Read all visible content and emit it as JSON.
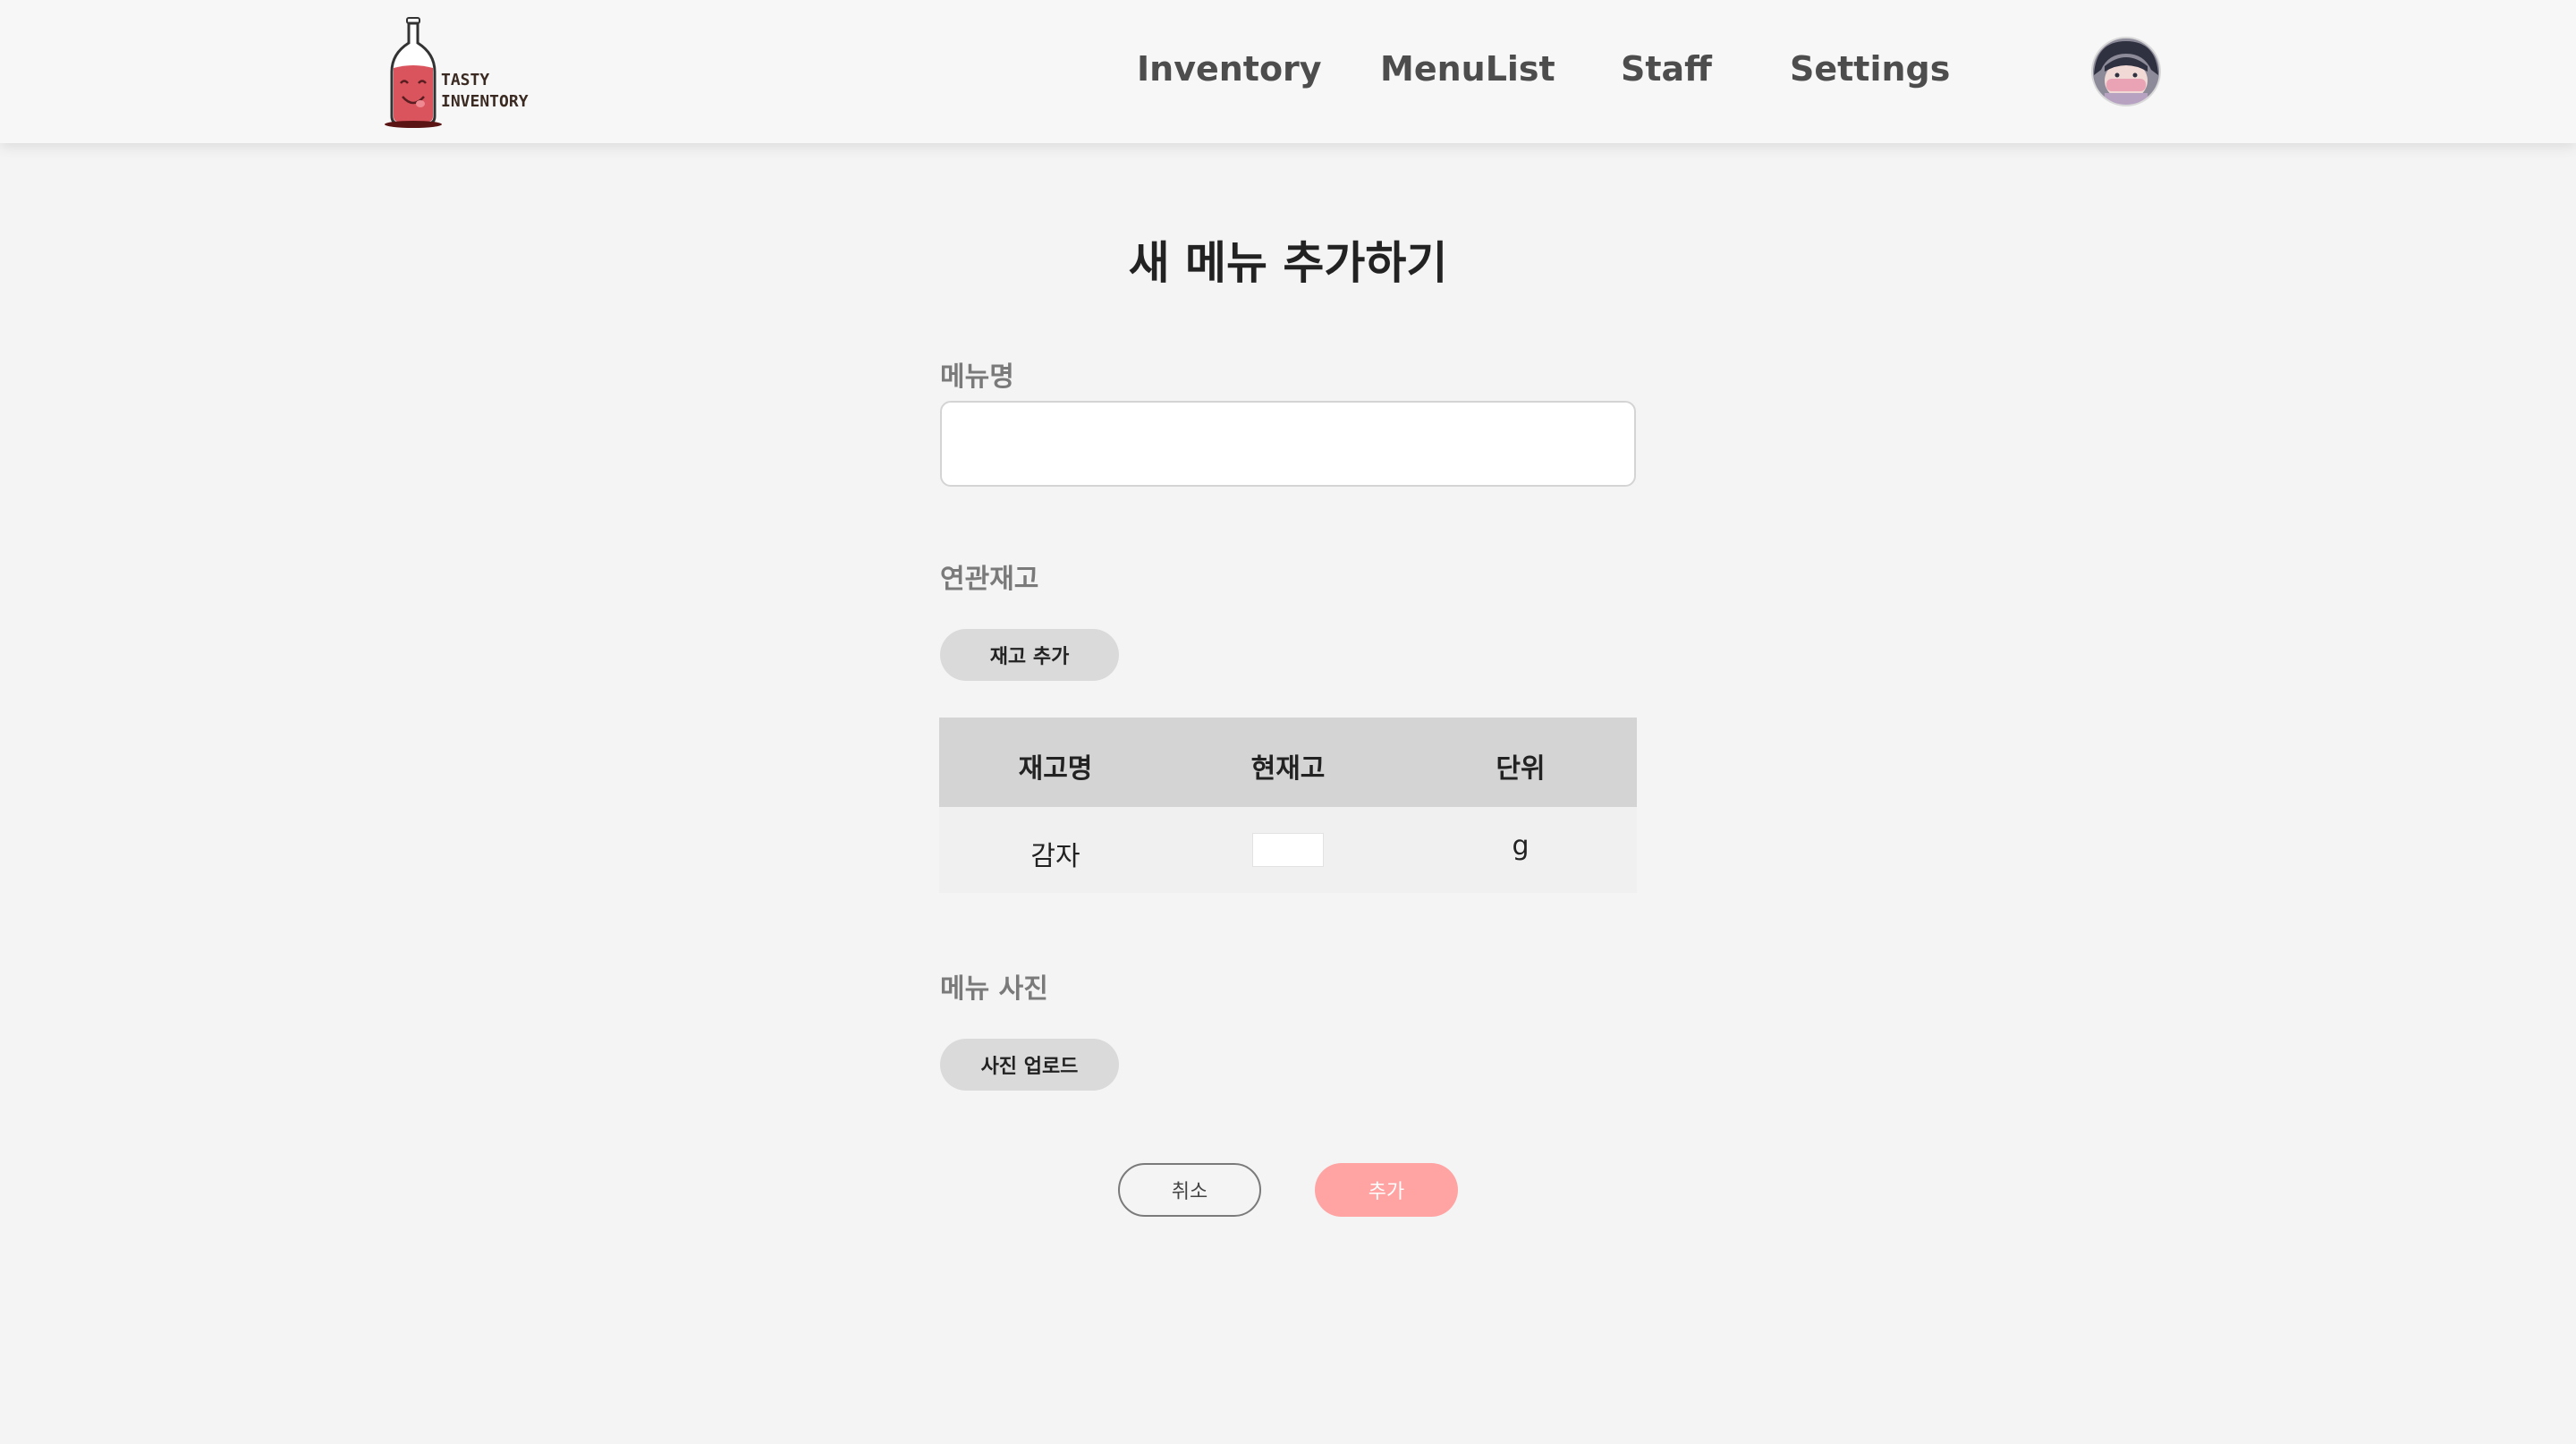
{
  "brand": {
    "line1": "TASTY",
    "line2": "INVENTORY"
  },
  "nav": {
    "inventory": "Inventory",
    "menulist": "MenuList",
    "staff": "Staff",
    "settings": "Settings"
  },
  "page": {
    "title": "새 메뉴 추가하기"
  },
  "form": {
    "menu_name_label": "메뉴명",
    "menu_name_value": "",
    "related_stock_label": "연관재고",
    "add_stock_button": "재고 추가",
    "photo_label": "메뉴 사진",
    "upload_photo_button": "사진 업로드",
    "cancel_button": "취소",
    "submit_button": "추가"
  },
  "stock_table": {
    "headers": [
      "재고명",
      "현재고",
      "단위"
    ],
    "rows": [
      {
        "name": "감자",
        "quantity": "",
        "unit": "g"
      }
    ]
  },
  "colors": {
    "background": "#f4f4f4",
    "navbar": "#f7f7f7",
    "submit_accent": "#ffa3a3",
    "logo_bottle": "#d9545d",
    "table_header": "#d4d4d4"
  }
}
